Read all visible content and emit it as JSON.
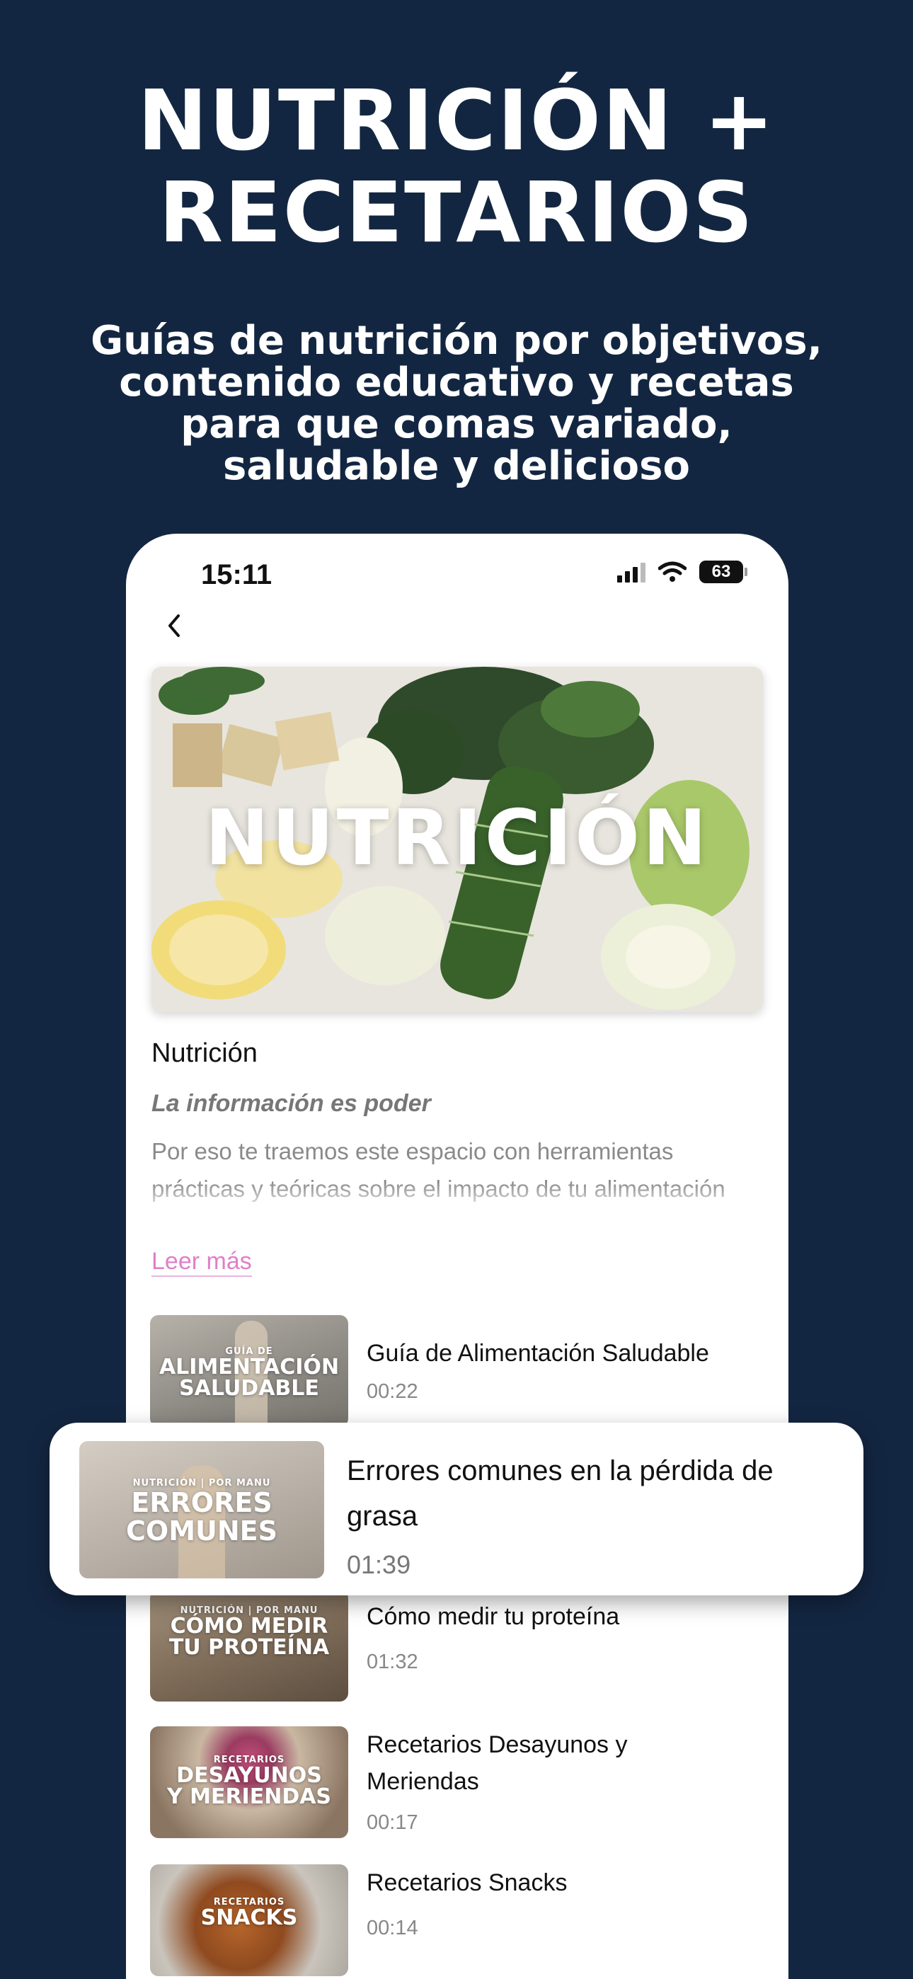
{
  "header": {
    "title_line1": "NUTRICIÓN +",
    "title_line2": "RECETARIOS",
    "subtitle_line1": "Guías de nutrición por objetivos,",
    "subtitle_line2": "contenido educativo y recetas",
    "subtitle_line3": "para que comas variado,",
    "subtitle_line4": "saludable y delicioso"
  },
  "status_bar": {
    "time": "15:11",
    "battery": "63"
  },
  "hero": {
    "overlay_text": "NUTRICIÓN"
  },
  "section": {
    "title": "Nutrición",
    "tagline": "La información es poder",
    "description": "Por eso te traemos este espacio con herramientas prácticas y teóricas sobre el impacto de tu alimentación en tu cuerpo, energía y bienestar",
    "read_more": "Leer más"
  },
  "videos": [
    {
      "thumb_kicker": "GUÍA DE",
      "thumb_line1": "ALIMENTACIÓN",
      "thumb_line2": "SALUDABLE",
      "title": "Guía de Alimentación Saludable",
      "duration": "00:22"
    },
    {
      "thumb_kicker": "NUTRICIÓN | POR MANU",
      "thumb_line1": "ERRORES",
      "thumb_line2": "COMUNES",
      "title": "Errores comunes en la pérdida de grasa",
      "duration": "01:39"
    },
    {
      "thumb_kicker": "NUTRICIÓN | POR MANU",
      "thumb_line1": "CÓMO MEDIR",
      "thumb_line2": "TU PROTEÍNA",
      "title": "Cómo medir tu proteína",
      "duration": "01:32"
    },
    {
      "thumb_kicker": "RECETARIOS",
      "thumb_line1": "DESAYUNOS",
      "thumb_line2": "Y MERIENDAS",
      "title": "Recetarios Desayunos y Meriendas",
      "duration": "00:17"
    },
    {
      "thumb_kicker": "RECETARIOS",
      "thumb_line1": "SNACKS",
      "thumb_line2": "",
      "title": "Recetarios Snacks",
      "duration": "00:14"
    }
  ],
  "colors": {
    "background": "#132641",
    "link": "#e07fc8"
  }
}
